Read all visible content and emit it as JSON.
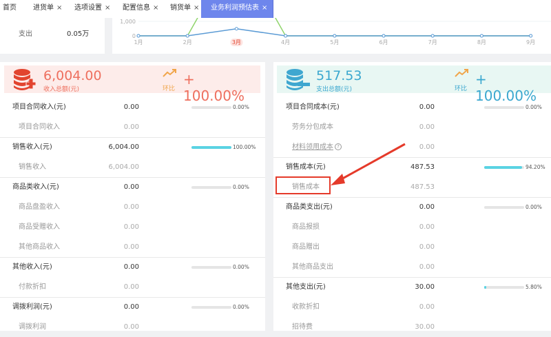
{
  "tabs": [
    {
      "label": "首页",
      "closable": false
    },
    {
      "label": "进货单",
      "closable": true
    },
    {
      "label": "选项设置",
      "closable": true
    },
    {
      "label": "配置信息",
      "closable": true
    },
    {
      "label": "销货单",
      "closable": true
    },
    {
      "label": "业务利润预估表",
      "closable": true,
      "active": true
    }
  ],
  "close_glyph": "×",
  "summary": {
    "label": "支出",
    "value": "0.05万"
  },
  "chart_data": {
    "type": "line",
    "categories": [
      "1月",
      "2月",
      "3月",
      "4月",
      "5月",
      "6月",
      "7月",
      "8月",
      "9月"
    ],
    "highlighted_category": "3月",
    "y_ticks": [
      "0",
      "1,000"
    ],
    "series": [
      {
        "color": "#8fd46b",
        "values": [
          0,
          0,
          6004,
          0,
          0,
          0,
          0,
          0,
          0
        ]
      },
      {
        "color": "#5b9bd5",
        "values": [
          0,
          0,
          487.53,
          0,
          0,
          0,
          0,
          0,
          0
        ]
      }
    ]
  },
  "income": {
    "amount": "6,004.00",
    "amount_label": "收入总额(元)",
    "trend_label": "环比",
    "change": "+ 100.00%",
    "color": "#ee6f5e",
    "icon": "database-plus-icon",
    "groups": [
      {
        "name": "项目合同收入(元)",
        "value": "0.00",
        "percent": 0,
        "percent_label": "0.00%",
        "items": [
          {
            "name": "项目合同收入",
            "value": "0.00"
          }
        ]
      },
      {
        "name": "销售收入(元)",
        "value": "6,004.00",
        "percent": 100,
        "percent_label": "100.00%",
        "items": [
          {
            "name": "销售收入",
            "value": "6,004.00"
          }
        ]
      },
      {
        "name": "商品类收入(元)",
        "value": "0.00",
        "percent": 0,
        "percent_label": "0.00%",
        "items": [
          {
            "name": "商品盘盈收入",
            "value": "0.00"
          },
          {
            "name": "商品受赠收入",
            "value": "0.00"
          },
          {
            "name": "其他商品收入",
            "value": "0.00"
          }
        ]
      },
      {
        "name": "其他收入(元)",
        "value": "0.00",
        "percent": 0,
        "percent_label": "0.00%",
        "items": [
          {
            "name": "付款折扣",
            "value": "0.00"
          }
        ]
      },
      {
        "name": "调拨利润(元)",
        "value": "0.00",
        "percent": 0,
        "percent_label": "0.00%",
        "items": [
          {
            "name": "调拨利润",
            "value": "0.00"
          }
        ]
      }
    ]
  },
  "expense": {
    "amount": "517.53",
    "amount_label": "支出总额(元)",
    "trend_label": "环比",
    "change": "+ 100.00%",
    "color": "#3aa7cf",
    "icon": "database-minus-icon",
    "groups": [
      {
        "name": "项目合同成本(元)",
        "value": "0.00",
        "percent": 0,
        "percent_label": "0.00%",
        "items": [
          {
            "name": "劳务分包成本",
            "value": "0.00"
          },
          {
            "name": "材料领用成本",
            "value": "0.00",
            "help": "?"
          }
        ]
      },
      {
        "name": "销售成本(元)",
        "value": "487.53",
        "percent": 94.2,
        "percent_label": "94.20%",
        "items": [
          {
            "name": "销售成本",
            "value": "487.53",
            "highlighted": true
          }
        ]
      },
      {
        "name": "商品类支出(元)",
        "value": "0.00",
        "percent": 0,
        "percent_label": "0.00%",
        "items": [
          {
            "name": "商品报损",
            "value": "0.00"
          },
          {
            "name": "商品赠出",
            "value": "0.00"
          },
          {
            "name": "其他商品支出",
            "value": "0.00"
          }
        ]
      },
      {
        "name": "其他支出(元)",
        "value": "30.00",
        "percent": 5.8,
        "percent_label": "5.80%",
        "items": [
          {
            "name": "收款折扣",
            "value": "0.00"
          },
          {
            "name": "招待费",
            "value": "30.00"
          }
        ]
      }
    ]
  }
}
